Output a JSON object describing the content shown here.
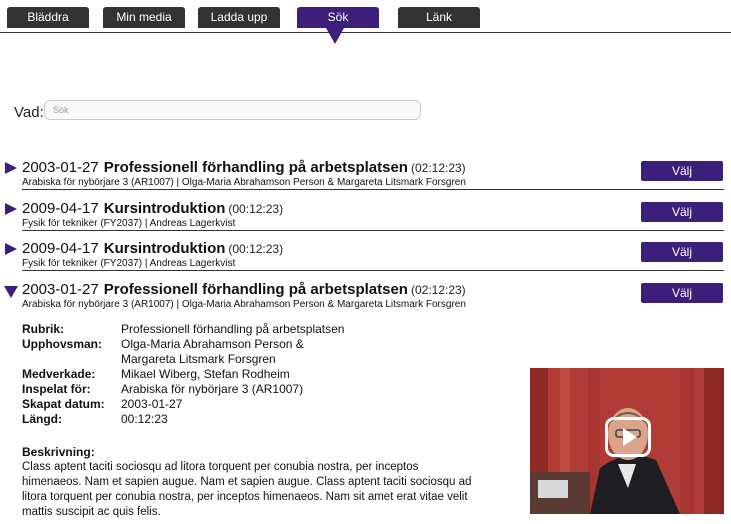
{
  "tabs": [
    {
      "label": "Bläddra",
      "active": false
    },
    {
      "label": "Min media",
      "active": false
    },
    {
      "label": "Ladda upp",
      "active": false
    },
    {
      "label": "Sök",
      "active": true
    },
    {
      "label": "Länk",
      "active": false
    }
  ],
  "search": {
    "label": "Vad:",
    "placeholder": "Sök",
    "value": ""
  },
  "results": [
    {
      "date": "2003-01-27",
      "title": "Professionell förhandling på arbetsplatsen",
      "duration": "(02:12:23)",
      "meta": "Arabiska för nybörjare 3 (AR1007) | Olga-Maria Abrahamson Person & Margareta Litsmark Forsgren",
      "button": "Välj",
      "expanded": false
    },
    {
      "date": "2009-04-17",
      "title": "Kursintroduktion",
      "duration": "(00:12:23)",
      "meta": "Fysik för tekniker (FY2037) | Andreas Lagerkvist",
      "button": "Välj",
      "expanded": false
    },
    {
      "date": "2009-04-17",
      "title": "Kursintroduktion",
      "duration": "(00:12:23)",
      "meta": "Fysik för tekniker (FY2037) | Andreas Lagerkvist",
      "button": "Välj",
      "expanded": false
    },
    {
      "date": "2003-01-27",
      "title": "Professionell förhandling på arbetsplatsen",
      "duration": "(02:12:23)",
      "meta": "Arabiska för nybörjare 3 (AR1007) | Olga-Maria Abrahamson Person & Margareta Litsmark Forsgren",
      "button": "Välj",
      "expanded": true
    }
  ],
  "details": {
    "rubrik_label": "Rubrik:",
    "rubrik": "Professionell förhandling på arbetsplatsen",
    "upphovsman_label": "Upphovsman:",
    "upphovsman_line1": "Olga-Maria Abrahamson Person &",
    "upphovsman_line2": "Margareta Litsmark Forsgren",
    "medverkade_label": "Medverkade:",
    "medverkade": "Mikael Wiberg, Stefan Rodheim",
    "inspelat_label": "Inspelat för:",
    "inspelat": "Arabiska för nybörjare 3 (AR1007)",
    "skapat_label": "Skapat datum:",
    "skapat": "2003-01-27",
    "langd_label": "Längd:",
    "langd": "00:12:23",
    "beskrivning_label": "Beskrivning:",
    "beskrivning": "Class aptent taciti sociosqu ad litora torquent per conubia nostra, per inceptos himenaeos. Nam et sapien augue. Nam et sapien augue. Class aptent taciti sociosqu ad litora torquent per conubia nostra, per inceptos himenaeos. Nam sit amet erat vitae velit mattis suscipit ac quis felis."
  },
  "colors": {
    "accent": "#3b1f7a",
    "tab": "#333333"
  },
  "icons": {
    "expand": "triangle-right-icon",
    "collapse": "triangle-down-icon",
    "play": "play-icon"
  }
}
